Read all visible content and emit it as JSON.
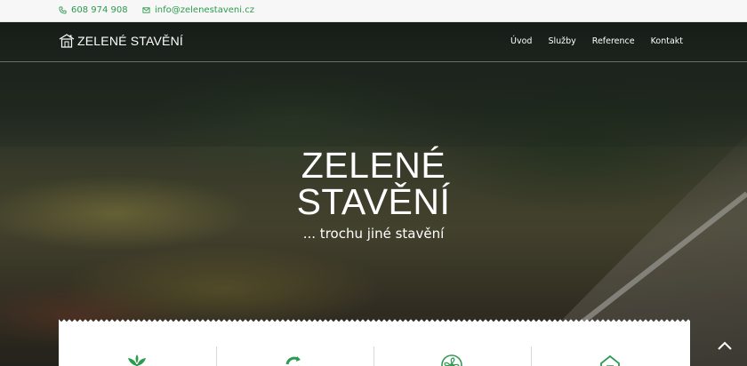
{
  "topbar": {
    "phone": "608 974 908",
    "email": "info@zelenestaveni.cz"
  },
  "header": {
    "logo_text": "ZELENÉ STAVĚNÍ",
    "nav": [
      {
        "label": "Úvod"
      },
      {
        "label": "Služby"
      },
      {
        "label": "Reference"
      },
      {
        "label": "Kontakt"
      }
    ]
  },
  "hero": {
    "title_line1": "ZELENÉ",
    "title_line2": "STAVĚNÍ",
    "subtitle": "... trochu jiné stavění"
  },
  "features": {
    "icons": [
      "plant-icon",
      "recycle-icon",
      "fan-icon",
      "house-icon"
    ]
  },
  "colors": {
    "accent": "#2c9a4f",
    "topbar_bg": "#f7f7f7"
  },
  "icons": {
    "phone": "phone-icon",
    "email": "mail-icon",
    "scroll_top": "chevron-up-icon"
  }
}
